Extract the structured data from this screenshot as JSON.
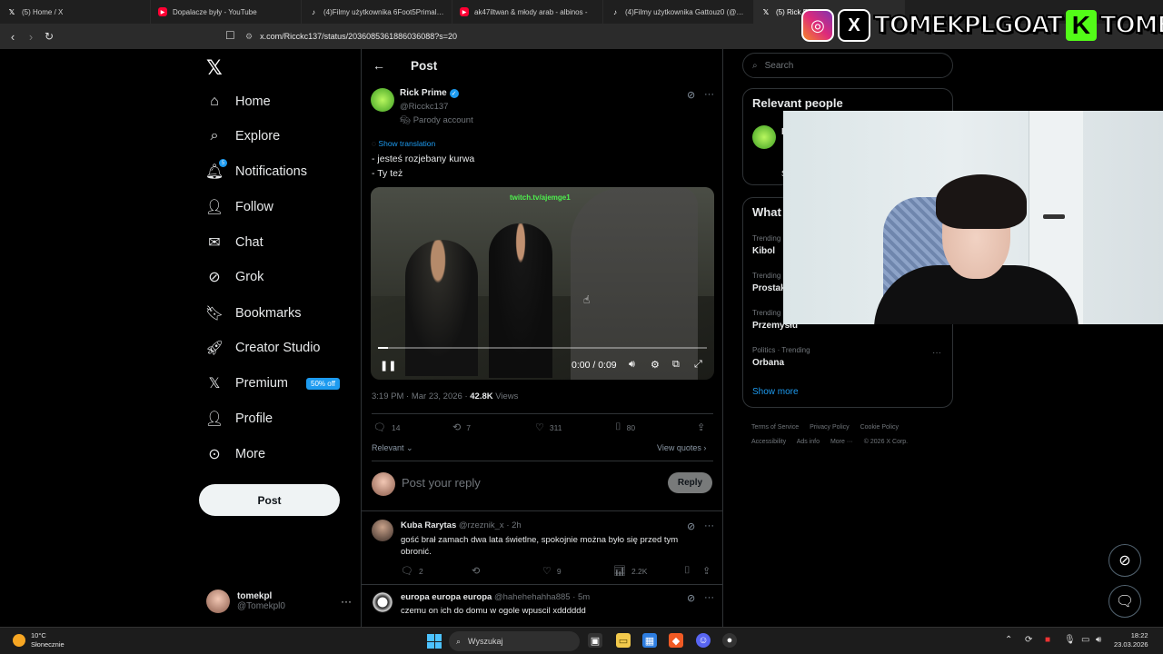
{
  "browser": {
    "tabs": [
      {
        "icon": "x-icon",
        "title": "(5) Home / X"
      },
      {
        "icon": "youtube-icon",
        "title": "Dopalacze były - YouTube"
      },
      {
        "icon": "tiktok-icon",
        "title": "(4)Filmy użytkownika 6Foot5PrimalR..."
      },
      {
        "icon": "youtube-icon",
        "title": "ak47iltwan & młody arab - albinos -"
      },
      {
        "icon": "tiktok-icon",
        "title": "(4)Filmy użytkownika Gattouz0 (@ga..."
      },
      {
        "icon": "x-icon",
        "title": "(5) Rick Prime"
      }
    ],
    "url": "x.com/Ricckc137/status/2036085361886036088?s=20"
  },
  "stream_banner": {
    "x_name": "TOMEKPLGOAT",
    "kick_letter": "K",
    "kick_name": "TOMEKPL"
  },
  "sidebar": {
    "items": [
      {
        "label": "Home",
        "icon": "home-icon"
      },
      {
        "label": "Explore",
        "icon": "search-icon"
      },
      {
        "label": "Notifications",
        "icon": "bell-icon",
        "badge": "5"
      },
      {
        "label": "Follow",
        "icon": "add-person-icon"
      },
      {
        "label": "Chat",
        "icon": "mail-icon"
      },
      {
        "label": "Grok",
        "icon": "grok-icon"
      },
      {
        "label": "Bookmarks",
        "icon": "bookmark-icon"
      },
      {
        "label": "Creator Studio",
        "icon": "rocket-icon"
      },
      {
        "label": "Premium",
        "icon": "x-icon",
        "badge": "50% off"
      },
      {
        "label": "Profile",
        "icon": "person-icon"
      },
      {
        "label": "More",
        "icon": "more-circle-icon"
      }
    ],
    "post_button": "Post",
    "account": {
      "name": "tomekpl",
      "handle": "@Tomekpl0"
    }
  },
  "post": {
    "header": "Post",
    "author": {
      "name": "Rick Prime",
      "handle": "@Ricckc137",
      "label": "Parody account"
    },
    "show_translation": "Show translation",
    "text_lines": [
      "- jesteś rozjebany kurwa",
      "- Ty też"
    ],
    "video": {
      "watermark": "twitch.tv/ajemge1",
      "time": "0:00 / 0:09",
      "progress": 0.03
    },
    "timestamp": "3:19 PM · Mar 23, 2026 ·",
    "views": "42.8K",
    "views_label": "Views",
    "stats": {
      "replies": "14",
      "reposts": "7",
      "likes": "311",
      "bookmarks": "80"
    },
    "sort": "Relevant",
    "view_quotes": "View quotes",
    "reply_placeholder": "Post your reply",
    "reply_button": "Reply"
  },
  "comments": [
    {
      "name": "Kuba Rarytas",
      "handle": "@rzeznik_x",
      "time": "· 2h",
      "text": "gość brał zamach dwa lata świetlne, spokojnie można było się przed tym obronić.",
      "replies": "2",
      "likes": "9",
      "views": "2.2K"
    },
    {
      "name": "europa europa europa",
      "handle": "@hahehehahha885",
      "time": "· 5m",
      "text": "czemu on ich do domu w ogole wpuscil xdddddd"
    }
  ],
  "right": {
    "search_placeholder": "Search",
    "relevant_title": "Relevant people",
    "relevant_person_initial": "F",
    "relevant_person_snippet": "S",
    "whats_title": "What",
    "trends": [
      {
        "category": "Trending",
        "name": "Kibol"
      },
      {
        "category": "Trending",
        "name": "Prostak"
      },
      {
        "category": "Trending",
        "name": "Przemysłu"
      },
      {
        "category": "Politics · Trending",
        "name": "Orbana"
      }
    ],
    "show_more": "Show more",
    "footer": [
      "Terms of Service",
      "Privacy Policy",
      "Cookie Policy",
      "Accessibility",
      "Ads info",
      "More ···",
      "© 2026 X Corp."
    ]
  },
  "taskbar": {
    "temp": "10°C",
    "weather": "Słonecznie",
    "search": "Wyszukaj",
    "time": "18:22",
    "date": "23.03.2026"
  }
}
